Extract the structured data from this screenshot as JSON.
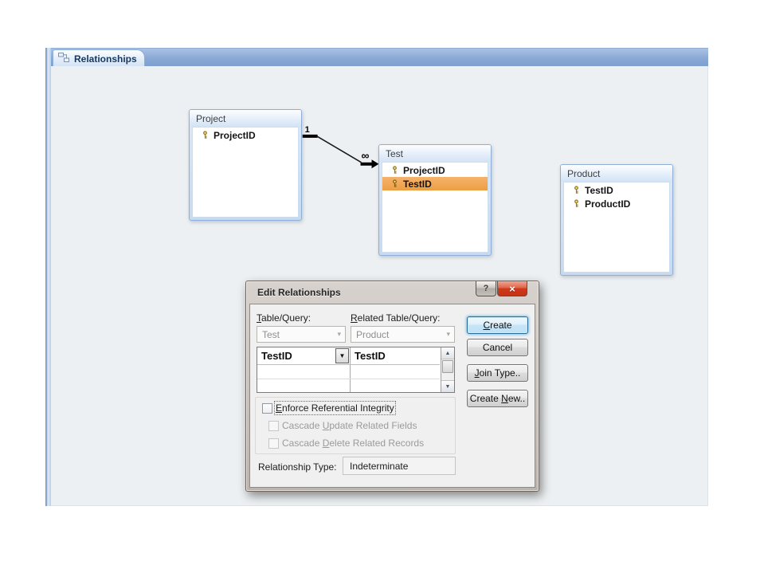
{
  "window": {
    "tab_label": "Relationships"
  },
  "icons": {
    "tab_icon": "relationships-diagram-icon",
    "key_icon": "primary-key-icon",
    "help_glyph": "?",
    "close_glyph": "×",
    "dropdown_arrow": "▼",
    "combo_arrow": "▾",
    "scroll_up": "▲",
    "scroll_down": "▼"
  },
  "colors": {
    "selection_orange": "#ec9f43",
    "table_border_blue": "#8fafd4",
    "tab_bar_blue": "#7e9fd0",
    "close_button_red": "#ce3a1d",
    "default_button_glow": "#7fc0e8",
    "canvas_bg": "#edf0f2"
  },
  "canvas": {
    "tables": [
      {
        "name": "Project",
        "fields": [
          {
            "name": "ProjectID",
            "key": true,
            "selected": false
          }
        ]
      },
      {
        "name": "Test",
        "fields": [
          {
            "name": "ProjectID",
            "key": true,
            "selected": false
          },
          {
            "name": "TestID",
            "key": true,
            "selected": true
          }
        ]
      },
      {
        "name": "Product",
        "fields": [
          {
            "name": "TestID",
            "key": true,
            "selected": false
          },
          {
            "name": "ProductID",
            "key": true,
            "selected": false
          }
        ]
      }
    ],
    "relationship": {
      "from": "Project",
      "to": "Test",
      "one_label": "1",
      "many_label": "∞"
    }
  },
  "dialog": {
    "title": "Edit Relationships",
    "table_query_label": "&Table/Query:",
    "related_table_query_label": "&Related Table/Query:",
    "table_query_value": "Test",
    "related_table_query_value": "Product",
    "grid": {
      "rows": [
        {
          "left": "TestID",
          "right": "TestID"
        }
      ]
    },
    "buttons": {
      "create": "&Create",
      "cancel": "Cancel",
      "join_type": "&Join Type..",
      "create_new": "Create &New.."
    },
    "checkboxes": [
      {
        "label": "&Enforce Referential Integrity",
        "checked": false,
        "enabled": true,
        "focused": true
      },
      {
        "label": "Cascade &Update Related Fields",
        "checked": false,
        "enabled": false,
        "focused": false
      },
      {
        "label": "Cascade &Delete Related Records",
        "checked": false,
        "enabled": false,
        "focused": false
      }
    ],
    "relationship_type_label": "Relationship Type:",
    "relationship_type_value": "Indeterminate"
  }
}
